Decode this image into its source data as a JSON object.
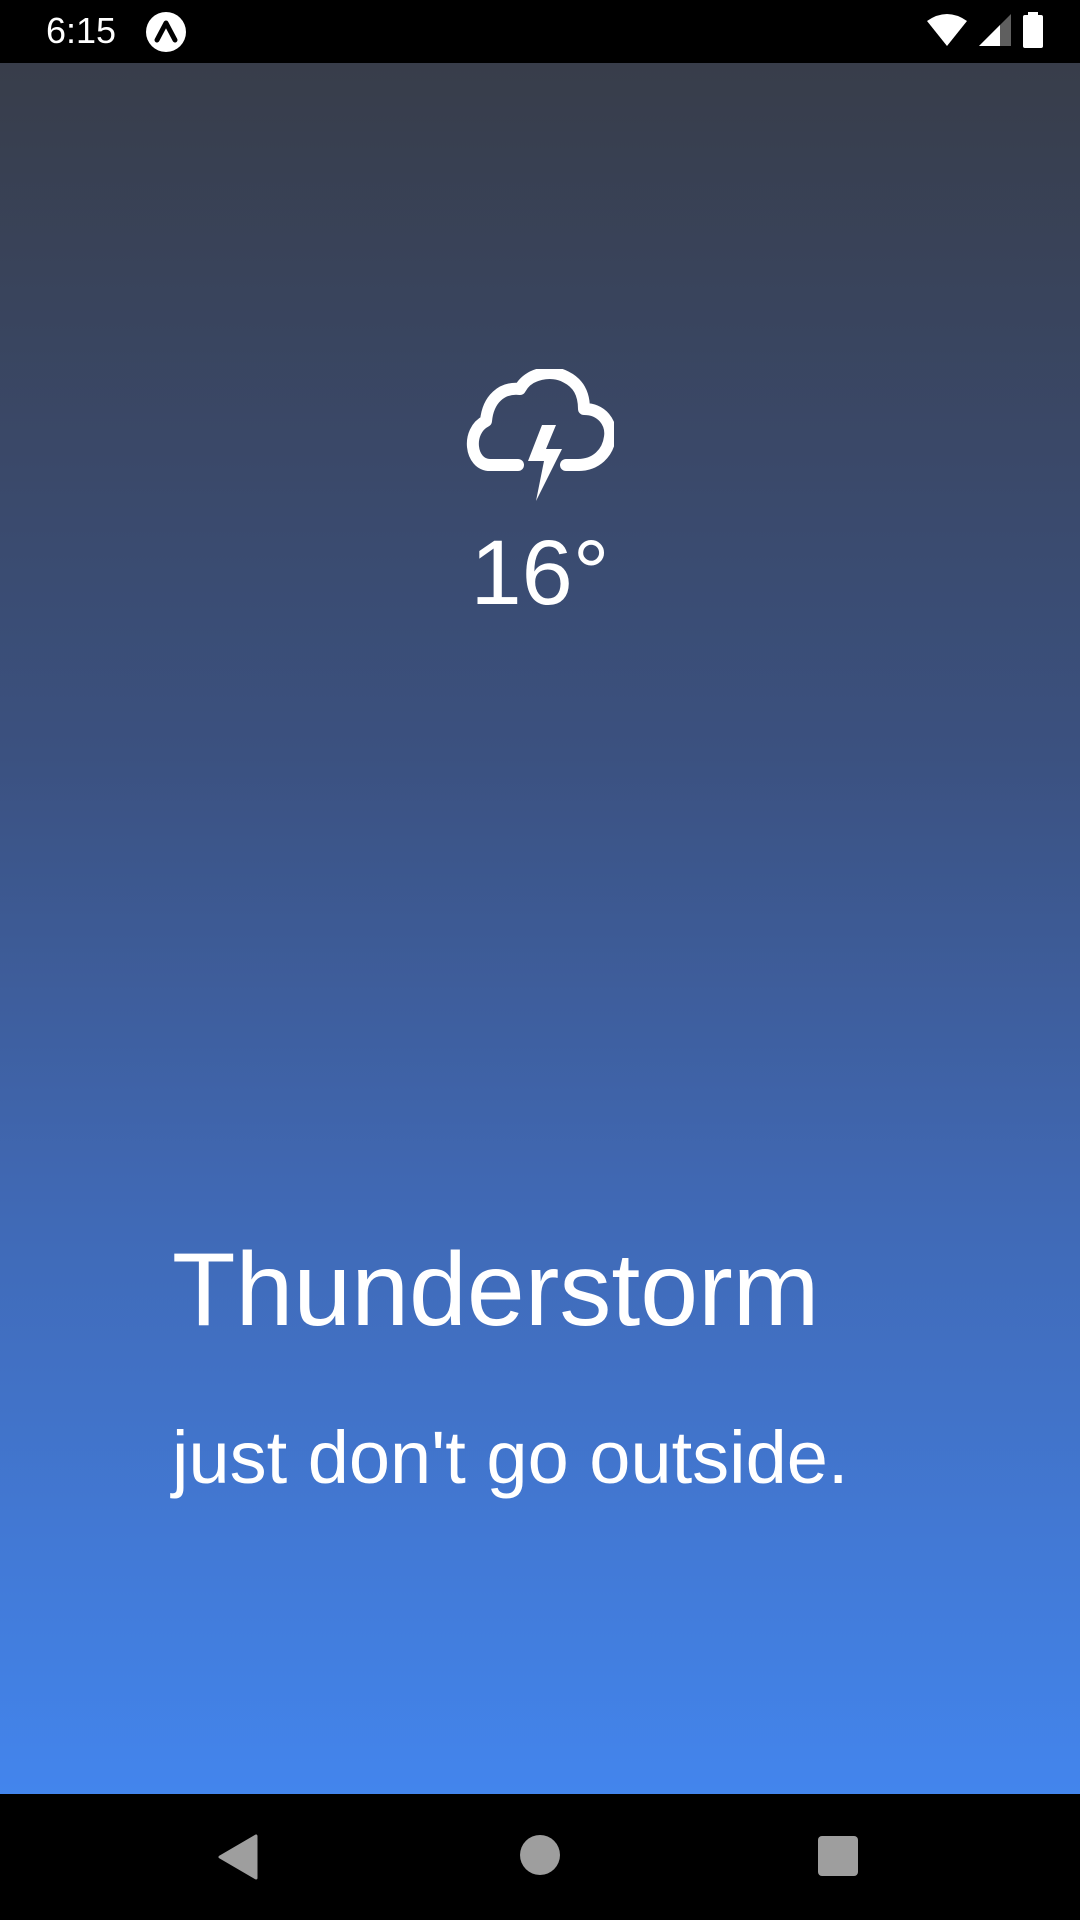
{
  "status_bar": {
    "time": "6:15",
    "app_icon": "expo-logo-icon",
    "wifi_icon": "wifi-icon",
    "signal_icon": "cell-signal-icon",
    "battery_icon": "battery-icon"
  },
  "weather": {
    "icon": "thunderstorm-icon",
    "temperature": "16°",
    "condition": "Thunderstorm",
    "subtitle": "just don't go outside."
  },
  "nav_bar": {
    "back_icon": "back-icon",
    "home_icon": "home-icon",
    "recents_icon": "recents-icon"
  },
  "colors": {
    "gradient_top": "#383d4a",
    "gradient_bottom": "#4385ed",
    "text": "#ffffff",
    "bar_background": "#000000",
    "nav_icon": "#9e9e9e"
  }
}
